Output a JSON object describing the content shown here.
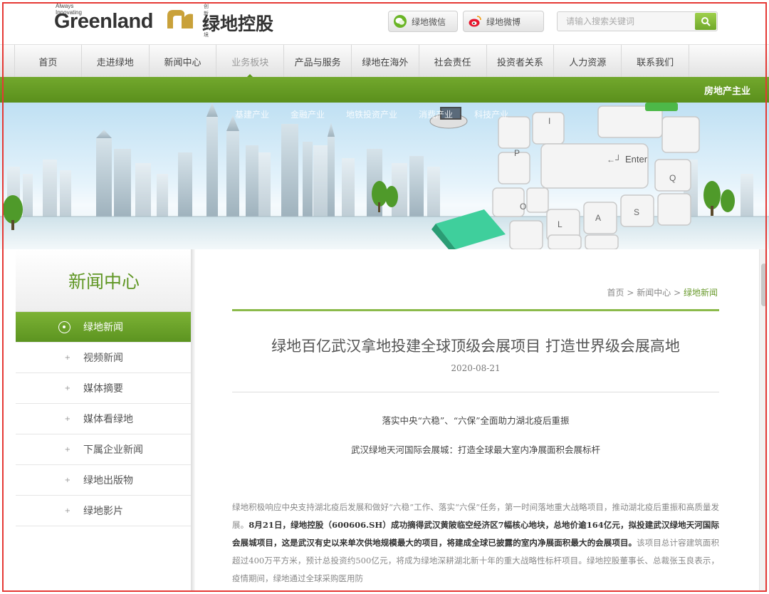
{
  "header": {
    "logo_text": "Greenland",
    "logo_tagline": "Always Innovating",
    "logo_cn_tagline": "创新无止境",
    "logo_cn": "绿地控股",
    "wechat_label": "绿地微信",
    "weibo_label": "绿地微博",
    "search_placeholder": "请输入搜索关键词"
  },
  "nav": {
    "items": [
      "首页",
      "走进绿地",
      "新闻中心",
      "业务板块",
      "产品与服务",
      "绿地在海外",
      "社会责任",
      "投资者关系",
      "人力资源",
      "联系我们"
    ],
    "active_index": 3
  },
  "subbar": {
    "label": "房地产主业"
  },
  "banner": {
    "links": [
      "基建产业",
      "金融产业",
      "地铁投资产业",
      "消费产业",
      "科技产业"
    ],
    "key_label": "Enter"
  },
  "sidebar": {
    "title": "新闻中心",
    "items": [
      "绿地新闻",
      "视频新闻",
      "媒体摘要",
      "媒体看绿地",
      "下属企业新闻",
      "绿地出版物",
      "绿地影片"
    ],
    "active_index": 0
  },
  "breadcrumb": {
    "home": "首页",
    "sep": ">",
    "section": "新闻中心",
    "current": "绿地新闻"
  },
  "article": {
    "title": "绿地百亿武汉拿地投建全球顶级会展项目 打造世界级会展高地",
    "date": "2020-08-21",
    "subhead1": "落实中央“六稳”、“六保”全面助力湖北疫后重振",
    "subhead2": "武汉绿地天河国际会展城：打造全球最大室内净展面积会展标杆",
    "p_normal1": "绿地积极响应中央支持湖北疫后发展和做好“六稳”工作、落实“六保”任务，第一时间落地重大战略项目，推动湖北疫后重振和高质量发展。",
    "p_bold": "8月21日，绿地控股（600606.SH）成功摘得武汉黄陂临空经济区7幅核心地块，总地价逾164亿元，拟投建武汉绿地天河国际会展城项目，这是武汉有史以来单次供地规模最大的项目，将建成全球已披露的室内净展面积最大的会展项目。",
    "p_normal2": "该项目总计容建筑面积超过400万平方米，预计总投资约500亿元，将成为绿地深耕湖北新十年的重大战略性标杆项目。绿地控股董事长、总裁张玉良表示，疫情期间，绿地通过全球采购医用防"
  },
  "colors": {
    "brand_green": "#6fa82a",
    "frame_red": "#e53935"
  }
}
